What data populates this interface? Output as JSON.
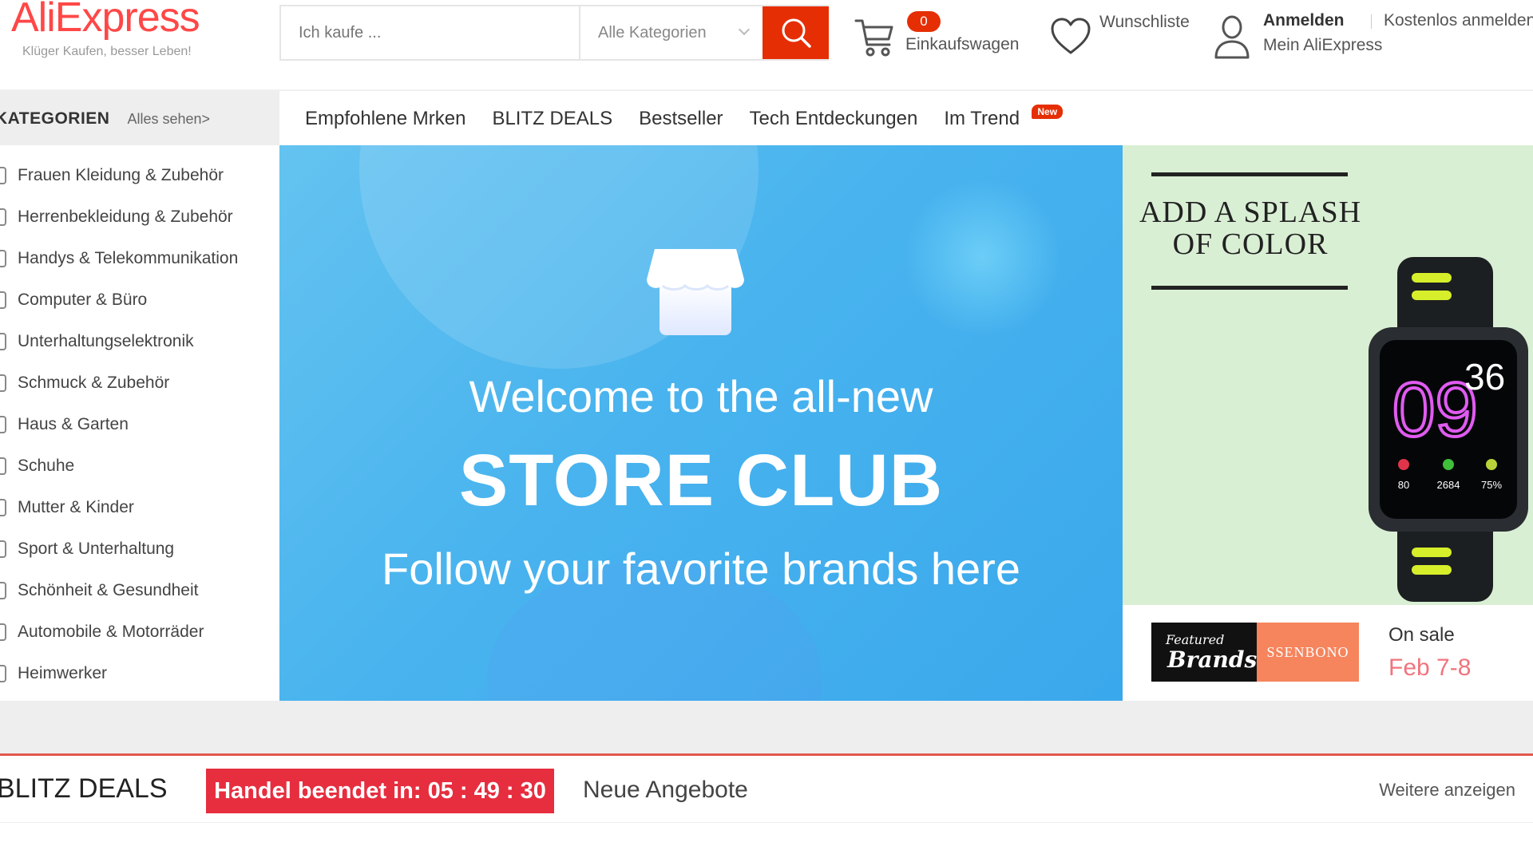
{
  "header": {
    "logo": "AliExpress",
    "tagline": "Klüger Kaufen, besser Leben!",
    "search_placeholder": "Ich kaufe ...",
    "category_select": "Alle Kategorien",
    "cart_count": "0",
    "cart_label": "Einkaufswagen",
    "wishlist_label": "Wunschliste",
    "signin_label": "Anmelden",
    "register_label": "Kostenlos anmelden",
    "my_account_label": "Mein AliExpress"
  },
  "nav": {
    "categories_title": "KATEGORIEN",
    "see_all": "Alles sehen>",
    "links": [
      "Empfohlene Mrken",
      "BLITZ DEALS",
      "Bestseller",
      "Tech Entdeckungen",
      "Im Trend"
    ],
    "new_badge": "New"
  },
  "sidebar": {
    "items": [
      "Frauen Kleidung & Zubehör",
      "Herrenbekleidung & Zubehör",
      "Handys & Telekommunikation",
      "Computer & Büro",
      "Unterhaltungselektronik",
      "Schmuck & Zubehör",
      "Haus & Garten",
      "Schuhe",
      "Mutter & Kinder",
      "Sport & Unterhaltung",
      "Schönheit & Gesundheit",
      "Automobile & Motorräder",
      "Heimwerker"
    ]
  },
  "hero": {
    "line1": "Welcome to the all-new",
    "line2": "STORE CLUB",
    "line3": "Follow your favorite brands here"
  },
  "promo": {
    "title_line1": "ADD A SPLASH",
    "title_line2": "OF COLOR",
    "watch_hour": "09",
    "watch_min": "36",
    "watch_stats": [
      "80",
      "2684",
      "75%"
    ],
    "featured_small": "Featured",
    "featured_big": "Brands",
    "brand_name": "SSENBONO",
    "sale_label": "On sale",
    "sale_date": "Feb 7-8"
  },
  "deals": {
    "title": "BLITZ DEALS",
    "timer": "Handel beendet in: 05 : 49 : 30",
    "new_offers": "Neue Angebote",
    "more": "Weitere anzeigen"
  },
  "colors": {
    "brand_red": "#e62e04",
    "hero_blue": "#48b3ee",
    "promo_green": "#d9efd4",
    "timer_red": "#e62e3f"
  }
}
